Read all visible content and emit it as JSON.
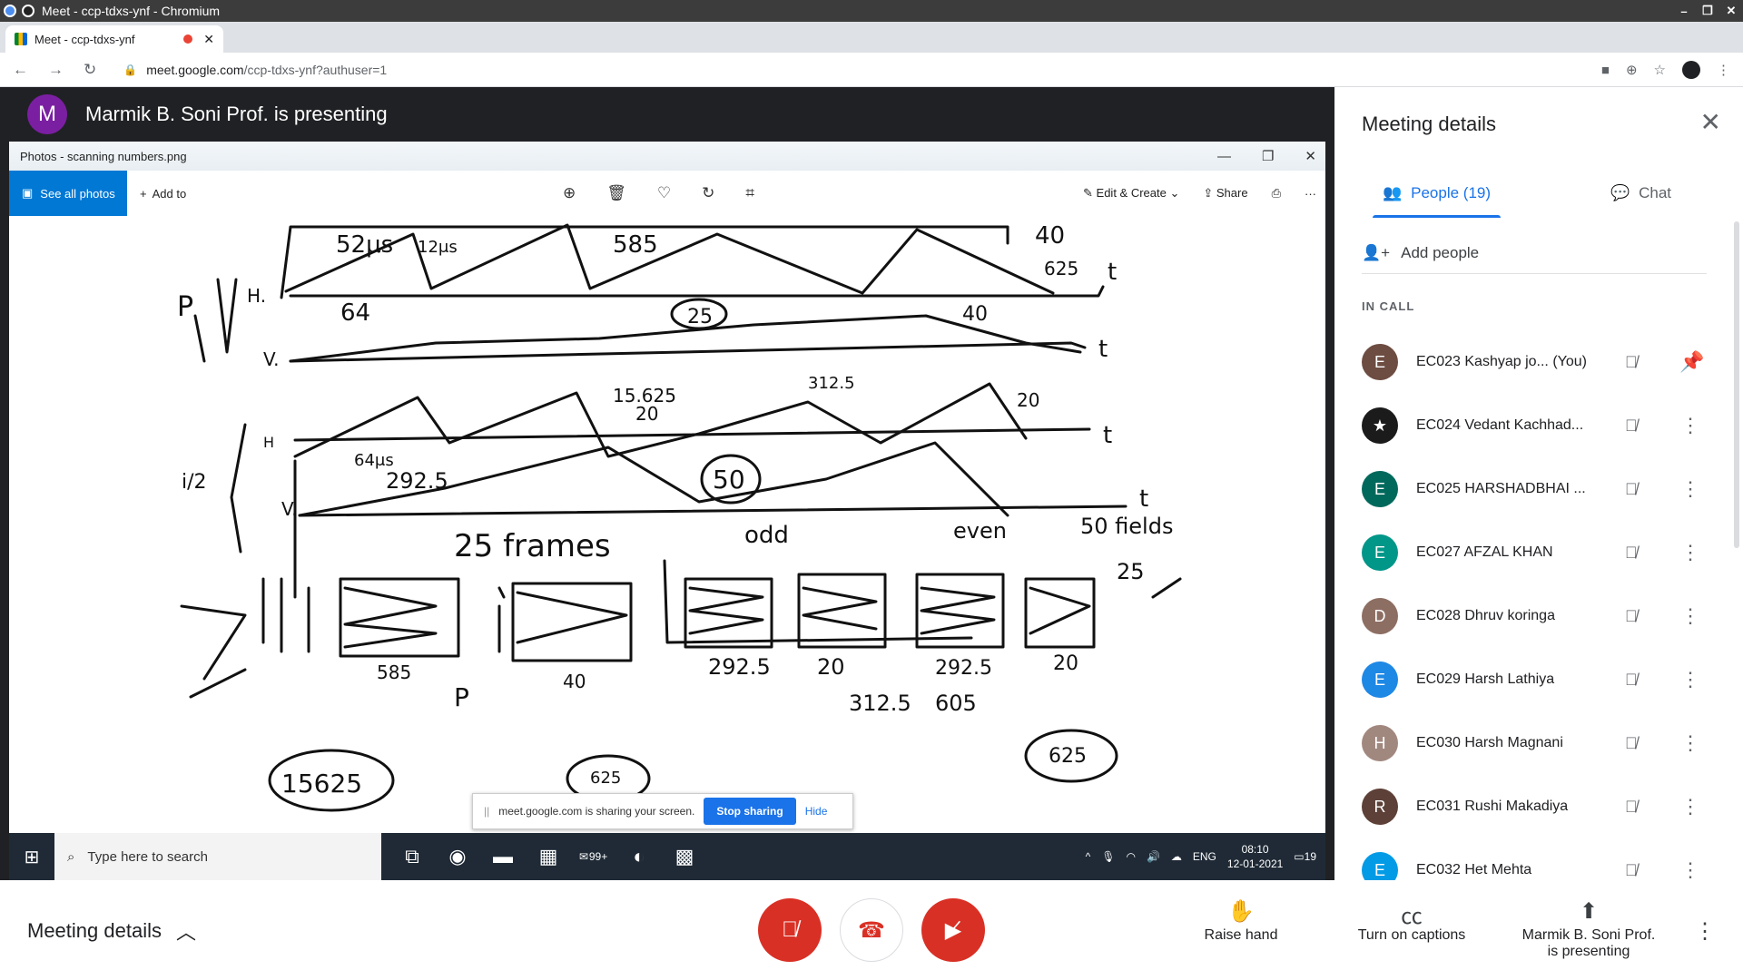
{
  "browser": {
    "window_title": "Meet - ccp-tdxs-ynf - Chromium",
    "tab_title": "Meet - ccp-tdxs-ynf",
    "url_host": "meet.google.com",
    "url_path": "/ccp-tdxs-ynf?authuser=1"
  },
  "presenter": {
    "initial": "M",
    "text": "Marmik B. Soni Prof. is presenting"
  },
  "photos": {
    "title": "Photos - scanning numbers.png",
    "see_all": "See all photos",
    "add_to": "Add to",
    "edit_create": "Edit & Create",
    "share": "Share"
  },
  "sharebar": {
    "message": "meet.google.com is sharing your screen.",
    "stop": "Stop sharing",
    "hide": "Hide"
  },
  "taskbar": {
    "search_placeholder": "Type here to search",
    "badge": "99+",
    "lang": "ENG",
    "time": "08:10",
    "date": "12-01-2021",
    "notif": "19"
  },
  "panel": {
    "title": "Meeting details",
    "tab_people": "People (19)",
    "tab_chat": "Chat",
    "add_people": "Add people",
    "section": "IN CALL",
    "participants": [
      {
        "initial": "E",
        "name": "EC023 Kashyap jo... (You)",
        "color": "#6d4c41",
        "action": "pin"
      },
      {
        "initial": "★",
        "name": "EC024 Vedant Kachhad...",
        "color": "#1b1b1b",
        "action": "more"
      },
      {
        "initial": "E",
        "name": "EC025 HARSHADBHAI ...",
        "color": "#00695c",
        "action": "more"
      },
      {
        "initial": "E",
        "name": "EC027 AFZAL KHAN",
        "color": "#009688",
        "action": "more"
      },
      {
        "initial": "D",
        "name": "EC028 Dhruv koringa",
        "color": "#8d6e63",
        "action": "more"
      },
      {
        "initial": "E",
        "name": "EC029 Harsh Lathiya",
        "color": "#1e88e5",
        "action": "more"
      },
      {
        "initial": "H",
        "name": "EC030 Harsh Magnani",
        "color": "#a1887f",
        "action": "more"
      },
      {
        "initial": "R",
        "name": "EC031 Rushi Makadiya",
        "color": "#5d4037",
        "action": "more"
      },
      {
        "initial": "E",
        "name": "EC032 Het Mehta",
        "color": "#039be5",
        "action": "more"
      }
    ]
  },
  "bottom": {
    "meeting_details": "Meeting details",
    "raise_hand": "Raise hand",
    "captions": "Turn on captions",
    "presenting_line1": "Marmik B. Soni Prof.",
    "presenting_line2": "is presenting"
  },
  "handwriting": {
    "t1": "52μs",
    "t2": "12μs",
    "t3": "585",
    "t4": "40",
    "t5": "625",
    "t6": "t",
    "t7": "H.",
    "t8": "64",
    "t9": "25",
    "t10": "40",
    "t11": "P",
    "t12": "V.",
    "t13": "t",
    "t14": "15.625",
    "t15": "20",
    "t16": "312.5",
    "t17": "20",
    "t18": "H",
    "t19": "64μs",
    "t20": "292.5",
    "t21": "50",
    "t22": "t",
    "t23": "i/2",
    "t24": "V.",
    "t25": "t",
    "t26": "25 frames",
    "t27": "odd",
    "t28": "even",
    "t29": "50 fields",
    "t30": "25",
    "t31": "585",
    "t32": "P",
    "t33": "15625",
    "t34": "40",
    "t35": "625",
    "t36": "292.5",
    "t37": "20",
    "t38": "312.5",
    "t39": "292.5",
    "t40": "605",
    "t41": "20",
    "t42": "625"
  }
}
